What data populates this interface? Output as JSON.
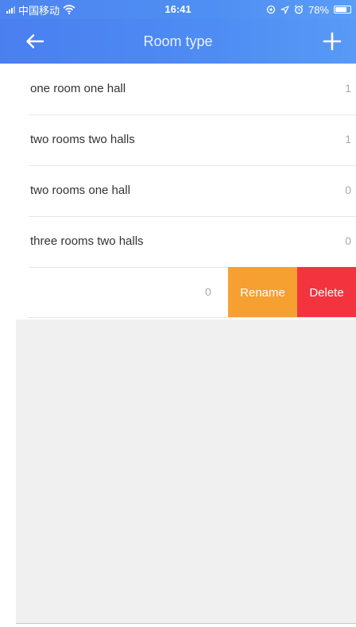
{
  "status_bar": {
    "carrier": "中国移动",
    "time": "16:41",
    "battery": "78%",
    "battery_level": 0.78,
    "icons": [
      "signal-icon",
      "wifi-icon",
      "location-icon",
      "navigation-icon",
      "alarm-icon",
      "battery-icon"
    ]
  },
  "header": {
    "title": "Room type",
    "back_icon": "arrow-left-icon",
    "add_icon": "plus-icon"
  },
  "room_types": [
    {
      "name": "one room one hall",
      "count": "1"
    },
    {
      "name": "two rooms two halls",
      "count": "1"
    },
    {
      "name": "two rooms one hall",
      "count": "0"
    },
    {
      "name": "three rooms two halls",
      "count": "0"
    }
  ],
  "swiped_item": {
    "count": "0",
    "rename_label": "Rename",
    "delete_label": "Delete"
  },
  "colors": {
    "header": "#4e8cf3",
    "rename": "#f6a032",
    "delete": "#f3343f",
    "background": "#f0f0f0"
  }
}
